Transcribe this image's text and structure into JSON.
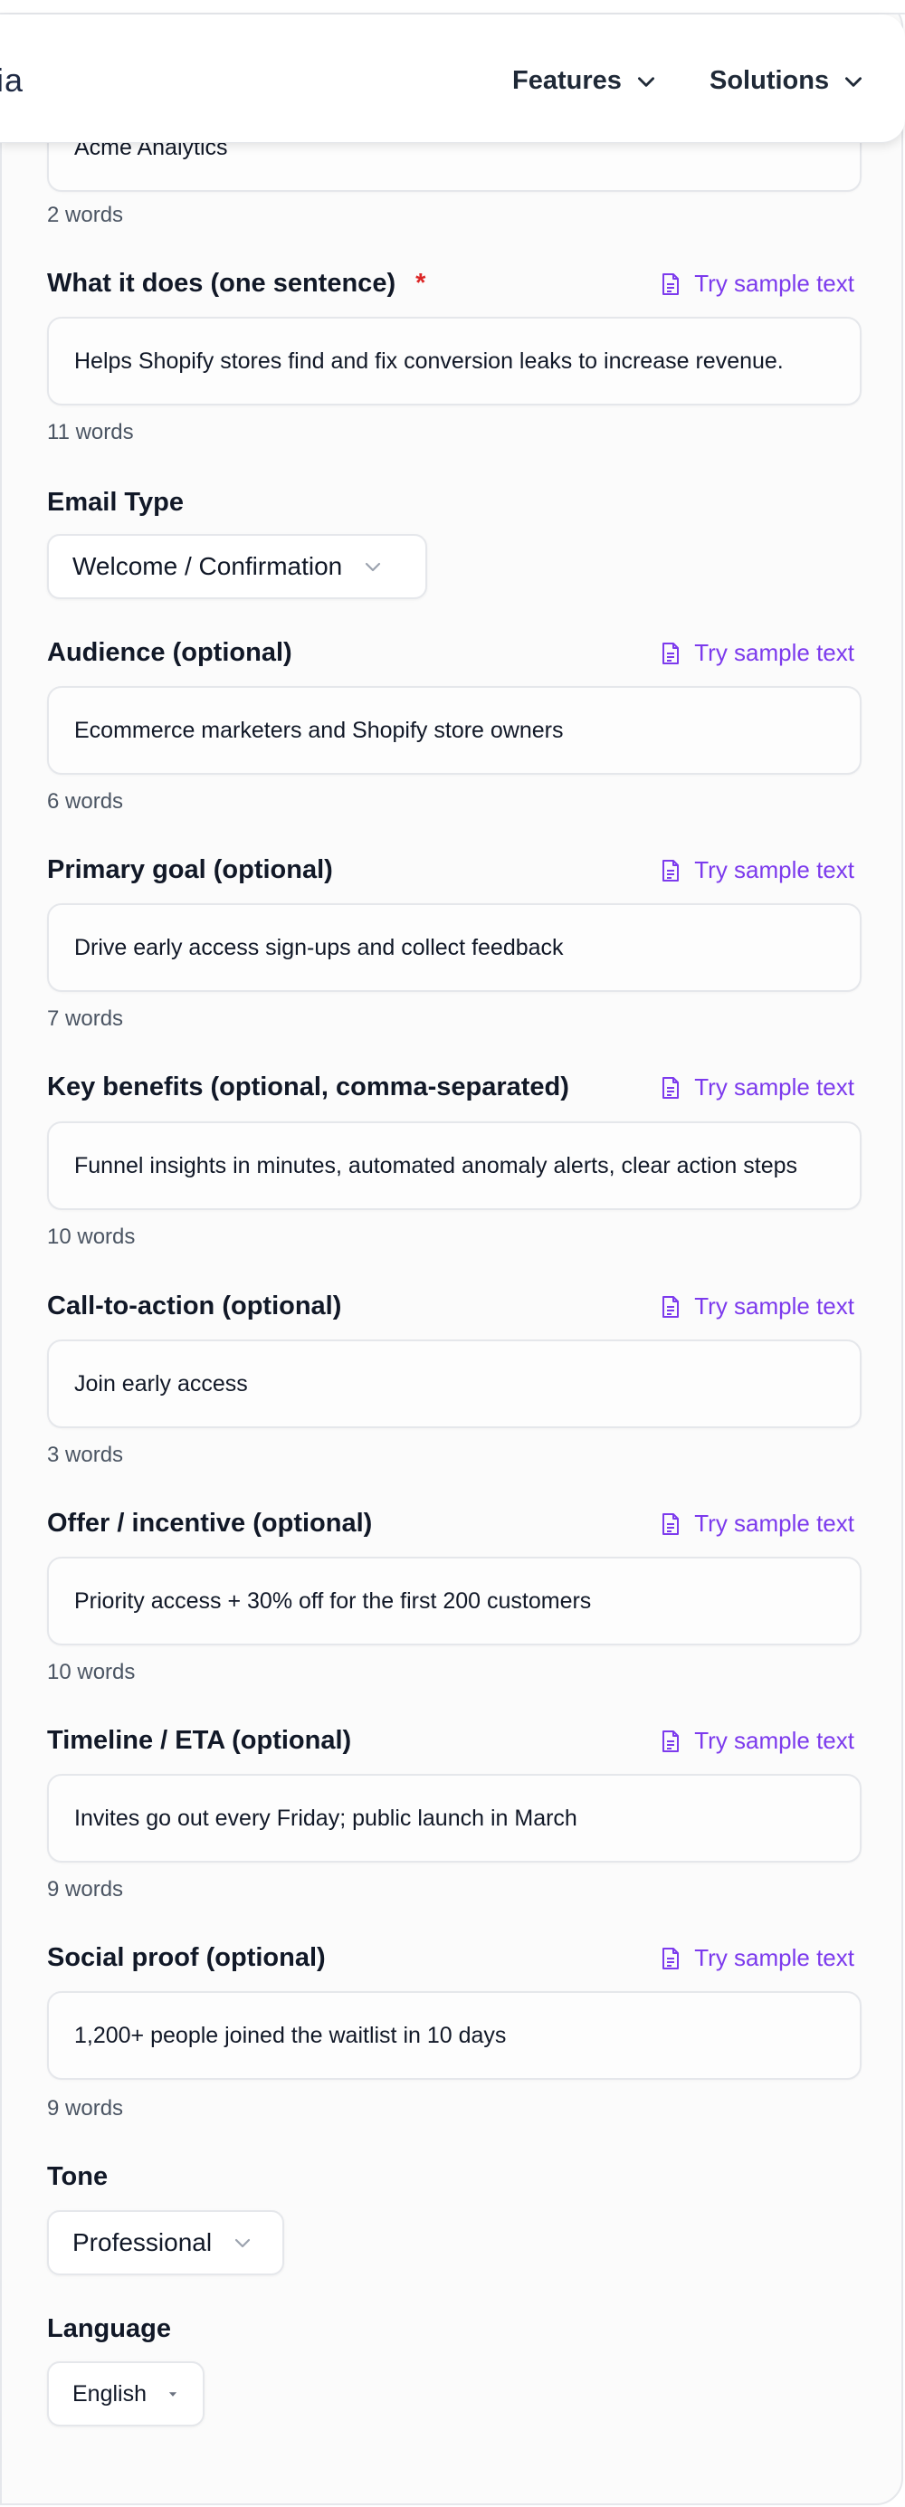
{
  "header": {
    "brand_fragment": "ia",
    "nav": [
      {
        "label": "Features"
      },
      {
        "label": "Solutions"
      }
    ]
  },
  "sample_link_label": "Try sample text",
  "product_name": {
    "value": "Acme Analytics",
    "word_count": "2 words"
  },
  "fields": [
    {
      "label": "What it does (one sentence)",
      "required_mark": "*",
      "value": "Helps Shopify stores find and fix conversion leaks to increase revenue.",
      "word_count": "11 words"
    },
    {
      "label": "Audience (optional)",
      "value": "Ecommerce marketers and Shopify store owners",
      "word_count": "6 words"
    },
    {
      "label": "Primary goal (optional)",
      "value": "Drive early access sign-ups and collect feedback",
      "word_count": "7 words"
    },
    {
      "label": "Key benefits (optional, comma-separated)",
      "value": "Funnel insights in minutes, automated anomaly alerts, clear action steps",
      "word_count": "10 words"
    },
    {
      "label": "Call-to-action (optional)",
      "value": "Join early access",
      "word_count": "3 words"
    },
    {
      "label": "Offer / incentive (optional)",
      "value": "Priority access + 30% off for the first 200 customers",
      "word_count": "10 words"
    },
    {
      "label": "Timeline / ETA (optional)",
      "value": "Invites go out every Friday; public launch in March",
      "word_count": "9 words"
    },
    {
      "label": "Social proof (optional)",
      "value": "1,200+ people joined the waitlist in 10 days",
      "word_count": "9 words"
    }
  ],
  "email_type": {
    "label": "Email Type",
    "selected": "Welcome / Confirmation"
  },
  "tone": {
    "label": "Tone",
    "selected": "Professional"
  },
  "language": {
    "label": "Language",
    "selected": "English"
  },
  "colors": {
    "accent": "#7c3aed",
    "required": "#dc2626",
    "text": "#111827",
    "muted": "#4b5563",
    "border": "#e5e7eb"
  },
  "icons": {
    "sample": "document-text-icon",
    "chevron": "chevron-down-icon",
    "caret": "caret-down-icon"
  }
}
